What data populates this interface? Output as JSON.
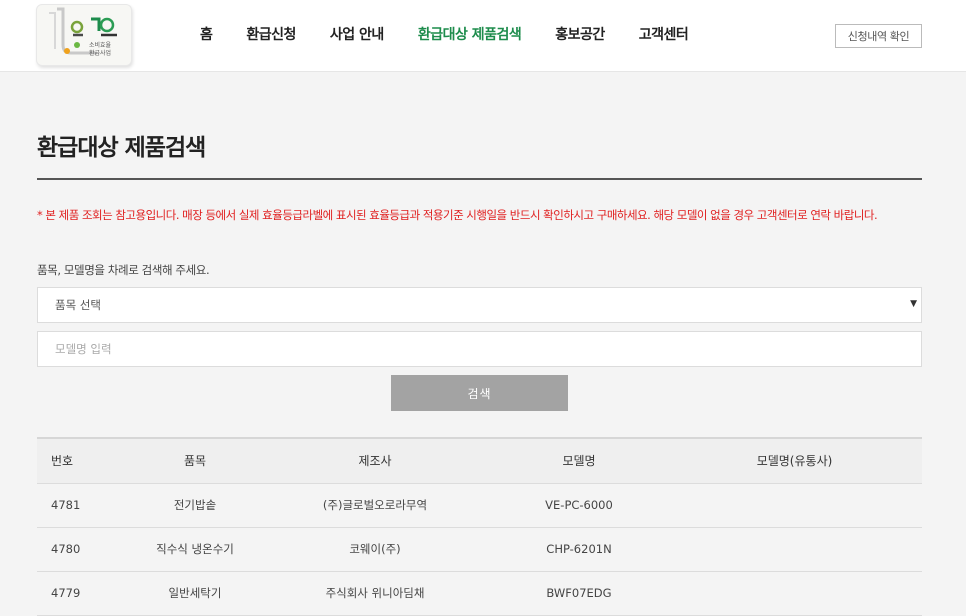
{
  "header": {
    "logo_line1": "소비효율",
    "logo_line2": "환급사업",
    "nav": [
      "홈",
      "환급신청",
      "사업 안내",
      "환급대상 제품검색",
      "홍보공간",
      "고객센터"
    ],
    "active_nav": "환급대상 제품검색",
    "history_button": "신청내역 확인"
  },
  "page": {
    "title": "환급대상 제품검색",
    "notice": "* 본 제품 조회는 참고용입니다. 매장 등에서 실제 효율등급라벨에 표시된 효율등급과 적용기준 시행일을 반드시 확인하시고 구매하세요. 해당 모델이 없을 경우 고객센터로 연락 바랍니다.",
    "instruction": "품목, 모델명을 차례로 검색해 주세요.",
    "category_select": "품목 선택",
    "model_placeholder": "모델명 입력",
    "search_button": "검색"
  },
  "table": {
    "columns": [
      "번호",
      "품목",
      "제조사",
      "모델명",
      "모델명(유통사)"
    ],
    "rows": [
      [
        "4781",
        "전기밥솥",
        "(주)글로벌오로라무역",
        "VE-PC-6000",
        ""
      ],
      [
        "4780",
        "직수식 냉온수기",
        "코웨이(주)",
        "CHP-6201N",
        ""
      ],
      [
        "4779",
        "일반세탁기",
        "주식회사 위니아딤채",
        "BWF07EDG",
        ""
      ]
    ]
  },
  "colors": {
    "accent_green": "#1d8c4c",
    "notice_red": "#e02020",
    "search_button_bg": "#a3a3a3"
  }
}
